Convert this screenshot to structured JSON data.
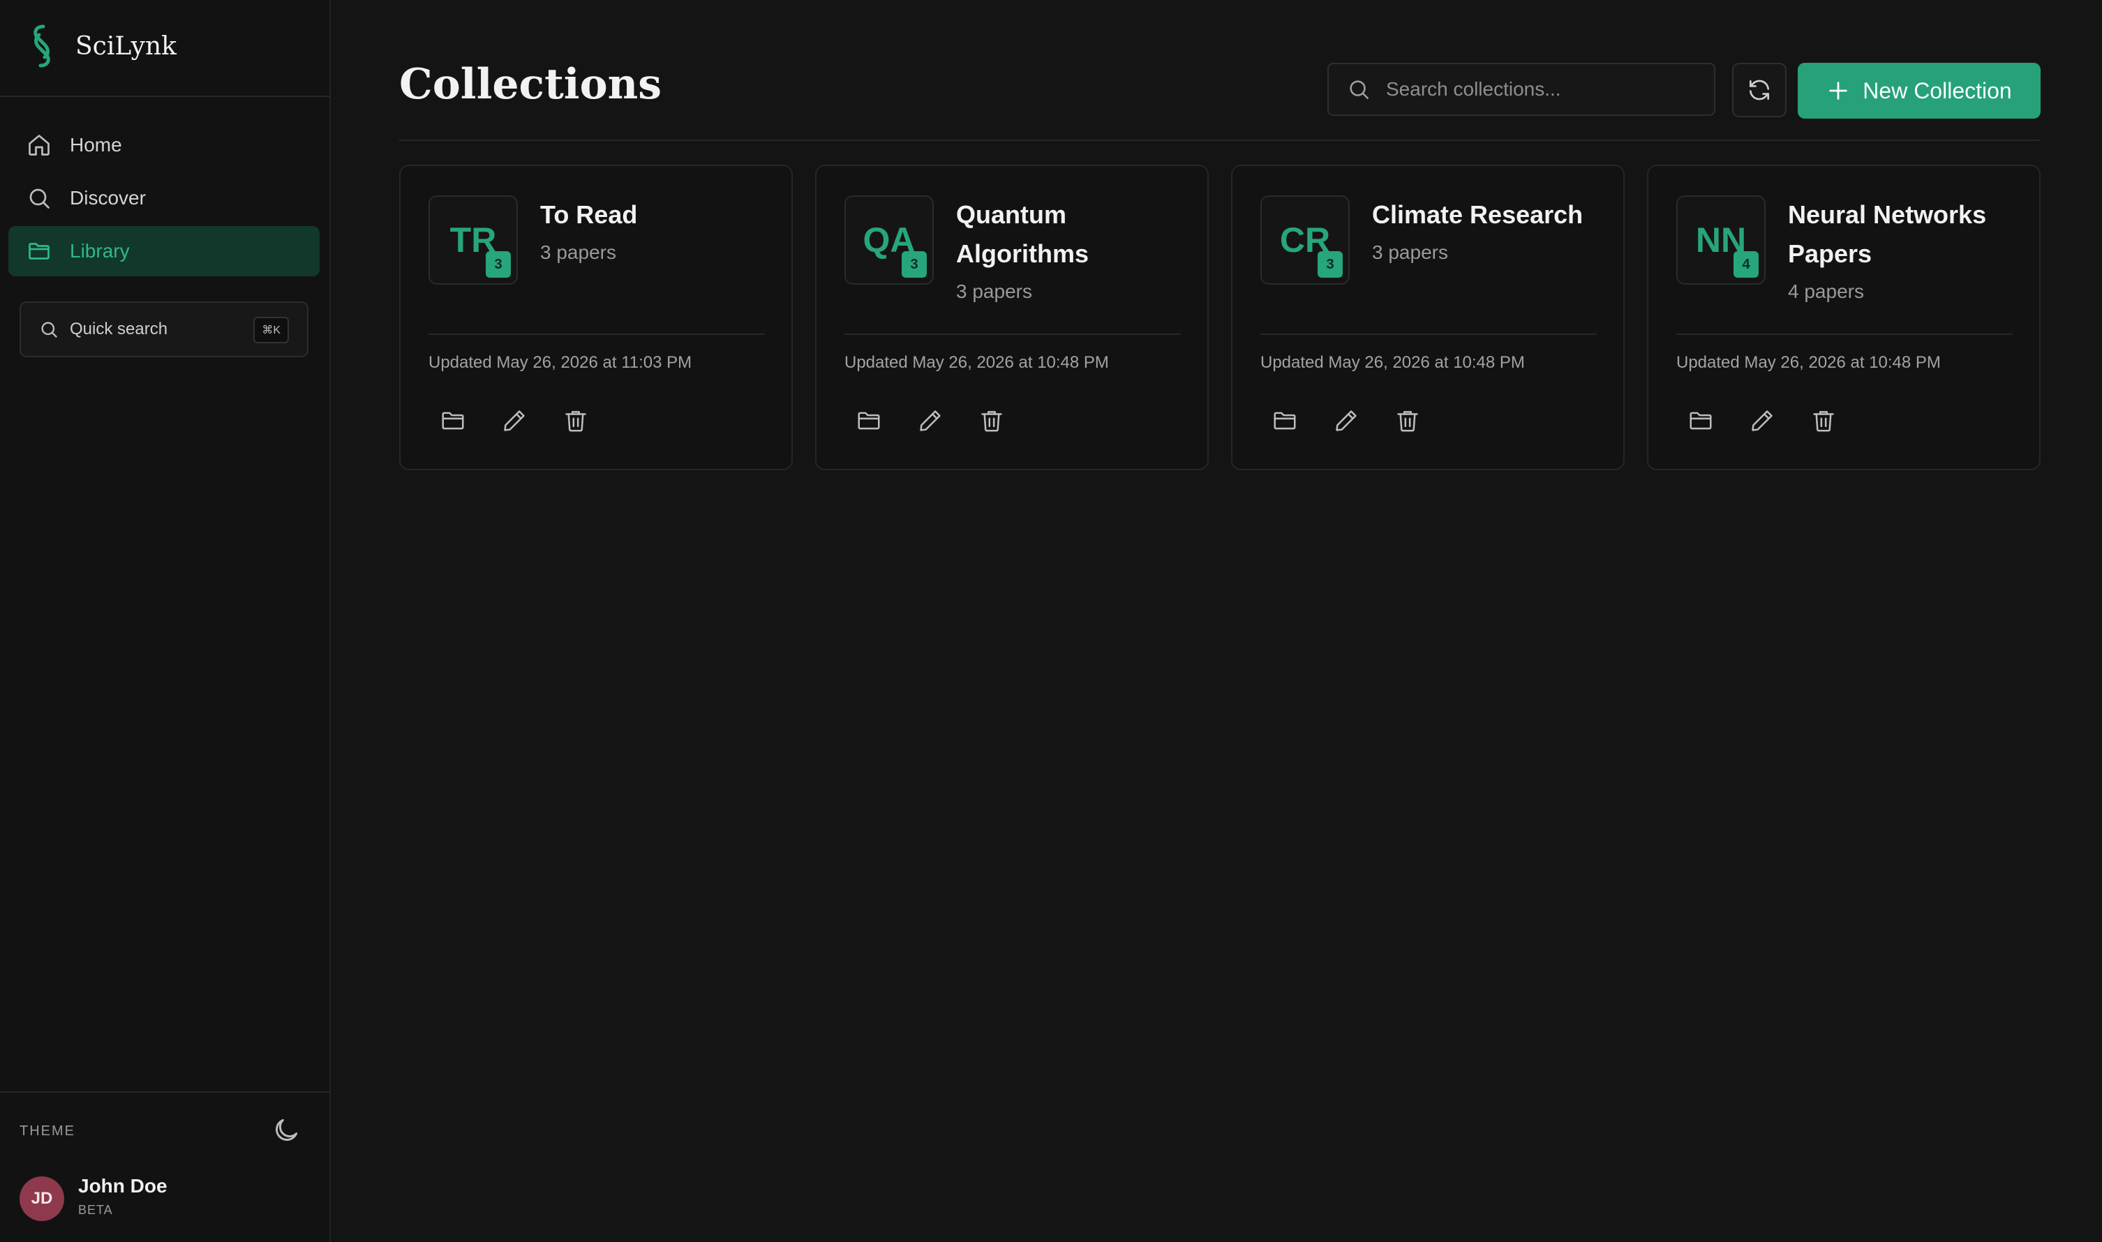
{
  "app": {
    "name": "SciLynk"
  },
  "colors": {
    "accent": "#26a17a",
    "active_bg": "#11382a",
    "background": "#141414",
    "avatar": "#8e3a4c"
  },
  "sidebar": {
    "nav": [
      {
        "label": "Home",
        "icon": "home-icon"
      },
      {
        "label": "Discover",
        "icon": "search-icon"
      },
      {
        "label": "Library",
        "icon": "folder-icon",
        "active": true
      }
    ],
    "quick_search": {
      "label": "Quick search",
      "shortcut": "⌘K"
    },
    "theme_label": "THEME",
    "theme_icon": "moon-icon",
    "user": {
      "initials": "JD",
      "name": "John Doe",
      "tag": "BETA"
    }
  },
  "header": {
    "title": "Collections",
    "search_placeholder": "Search collections...",
    "refresh_icon": "refresh-icon",
    "new_button": "New Collection"
  },
  "collections": [
    {
      "initials": "TR",
      "count": "3",
      "title": "To Read",
      "papers": "3 papers",
      "updated": "Updated May 26, 2026 at 11:03 PM"
    },
    {
      "initials": "QA",
      "count": "3",
      "title": "Quantum Algorithms",
      "papers": "3 papers",
      "updated": "Updated May 26, 2026 at 10:48 PM"
    },
    {
      "initials": "CR",
      "count": "3",
      "title": "Climate Research",
      "papers": "3 papers",
      "updated": "Updated May 26, 2026 at 10:48 PM"
    },
    {
      "initials": "NN",
      "count": "4",
      "title": "Neural Networks Papers",
      "papers": "4 papers",
      "updated": "Updated May 26, 2026 at 10:48 PM"
    }
  ]
}
